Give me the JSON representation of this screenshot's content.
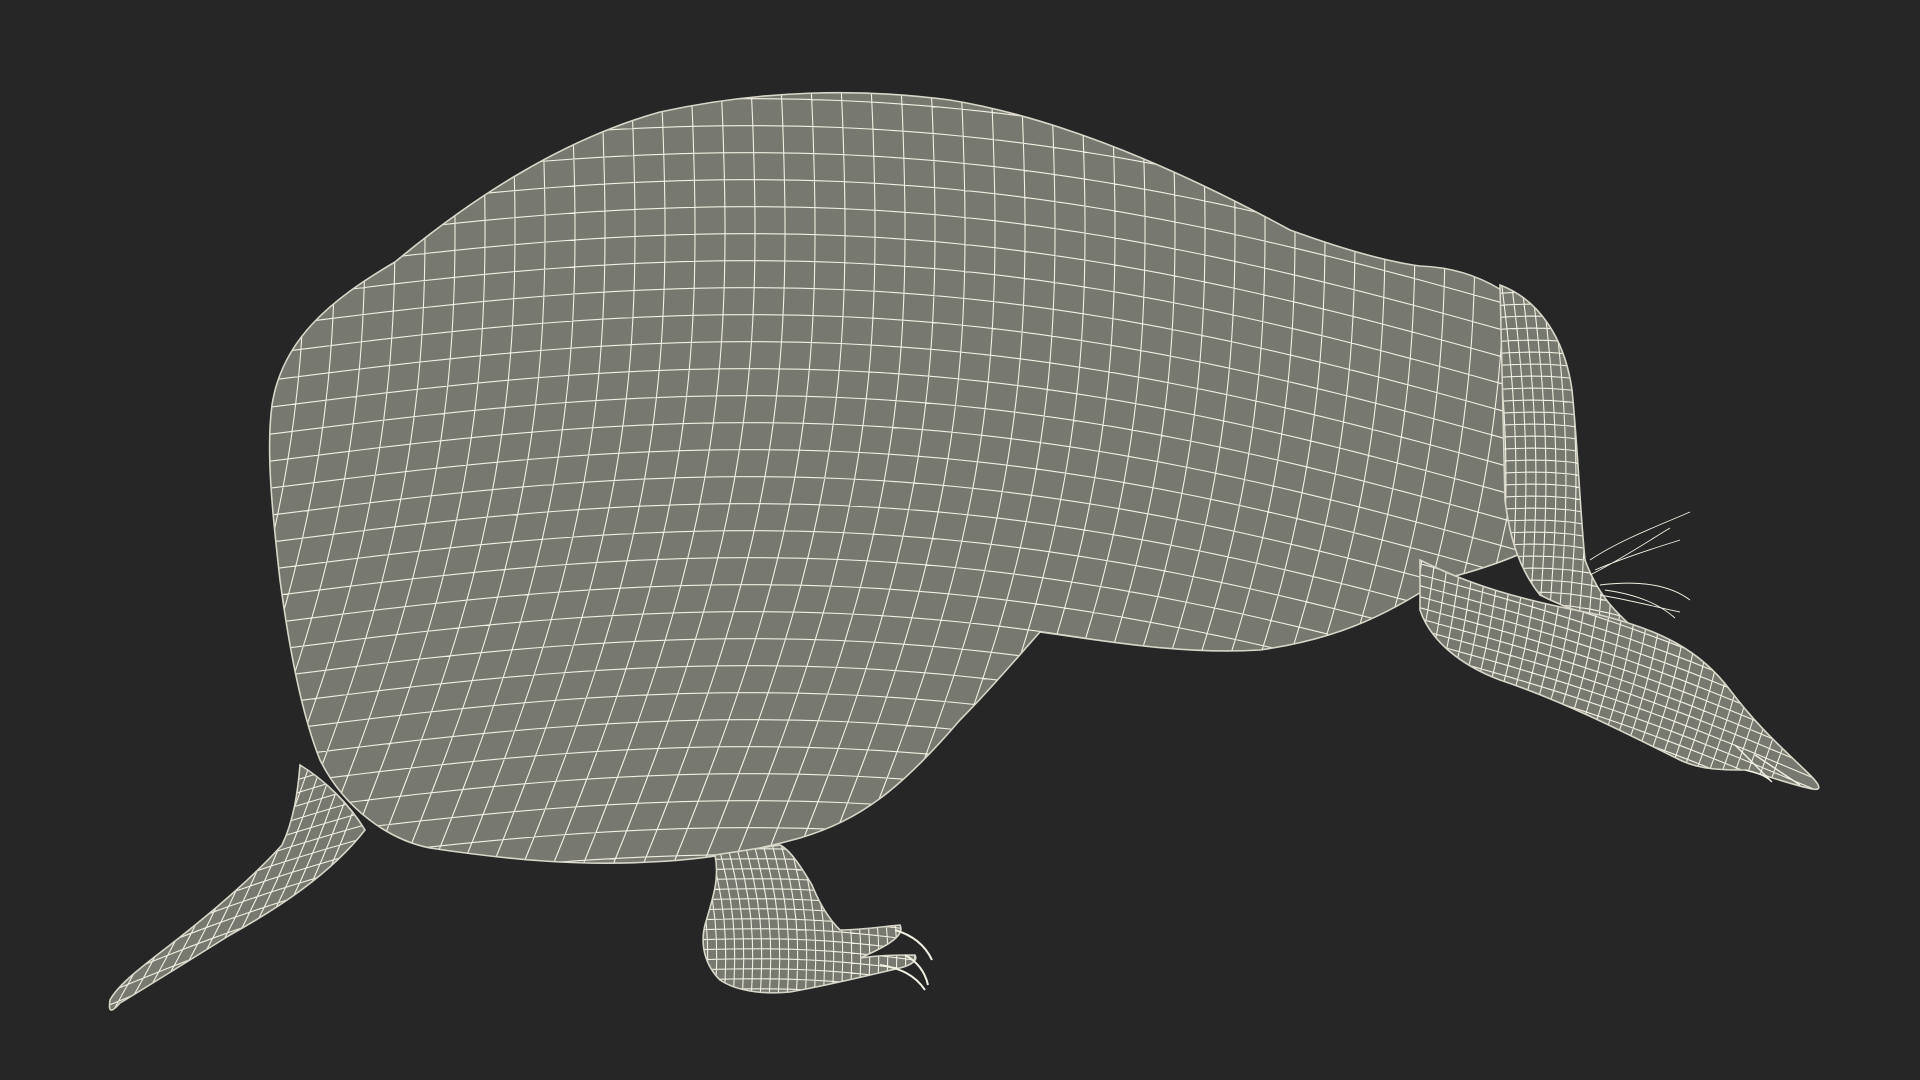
{
  "scene": {
    "subject": "wireframe-mole-model",
    "render_mode": "wireframe",
    "colors": {
      "background": "#262626",
      "mesh_fill": "#777870",
      "wire": "#f2f0e2",
      "wire_dark": "#d8d6c8"
    }
  }
}
